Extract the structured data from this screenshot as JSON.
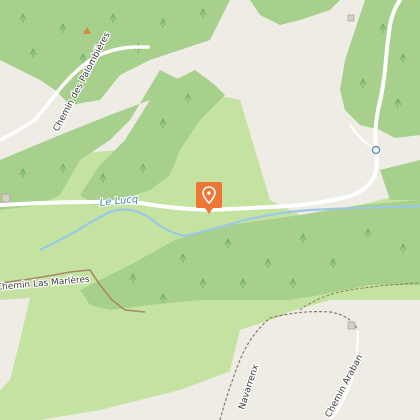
{
  "map": {
    "colors": {
      "background": "#eeece4",
      "forest": "#a7d08c",
      "meadow": "#c4e3a0",
      "water": "#9cc8e6",
      "road": "#ffffff",
      "track": "#a58b6a",
      "path": "#8a7a6a",
      "marker": "#f07636"
    },
    "labels": {
      "river": "Le Lucq",
      "road_palombieres": "Chemin des Palombières",
      "road_marleres": "Chemin Las Marlères",
      "road_navarrenx": "Navarrenx",
      "road_araban": "Chemin Araban"
    },
    "marker": {
      "icon": "map-pin-icon",
      "label": ""
    },
    "point_of_interest": {
      "icon": "peak-triangle-icon"
    }
  }
}
